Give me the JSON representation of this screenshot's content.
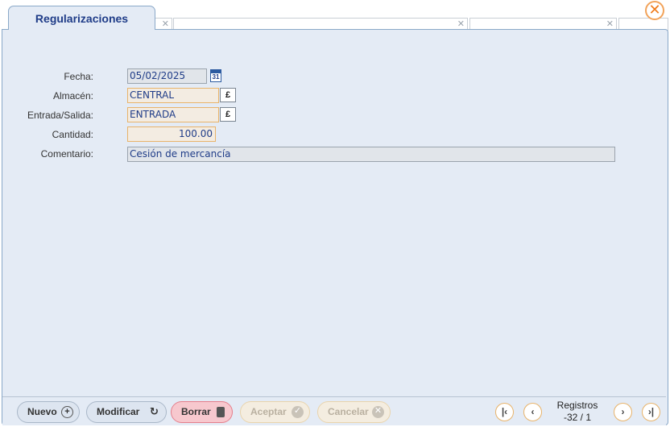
{
  "tab": {
    "title": "Regularizaciones"
  },
  "form": {
    "fecha": {
      "label": "Fecha:",
      "value": "05/02/2025",
      "calendar_day": "31"
    },
    "almacen": {
      "label": "Almacén:",
      "value": "CENTRAL"
    },
    "entrada_salida": {
      "label": "Entrada/Salida:",
      "value": "ENTRADA"
    },
    "cantidad": {
      "label": "Cantidad:",
      "value": "100.00"
    },
    "comentario": {
      "label": "Comentario:",
      "value": "Cesión de mercancía"
    }
  },
  "footer": {
    "nuevo": "Nuevo",
    "modificar": "Modificar",
    "borrar": "Borrar",
    "aceptar": "Aceptar",
    "cancelar": "Cancelar",
    "registros_label": "Registros",
    "registros_value": "-32 / 1"
  },
  "icons": {
    "close": "close-icon",
    "calendar": "calendar-icon",
    "lookup": "lookup-icon",
    "add": "plus-circle-icon",
    "refresh": "refresh-icon",
    "trash": "trash-icon",
    "check": "check-circle-icon",
    "cancel": "x-circle-icon",
    "first": "first-page-icon",
    "prev": "prev-icon",
    "next": "next-icon",
    "last": "last-page-icon"
  },
  "colors": {
    "accent": "#1f3c88",
    "panel": "#e4ebf5",
    "orange": "#f07b1a",
    "danger": "#f7c8ce"
  }
}
